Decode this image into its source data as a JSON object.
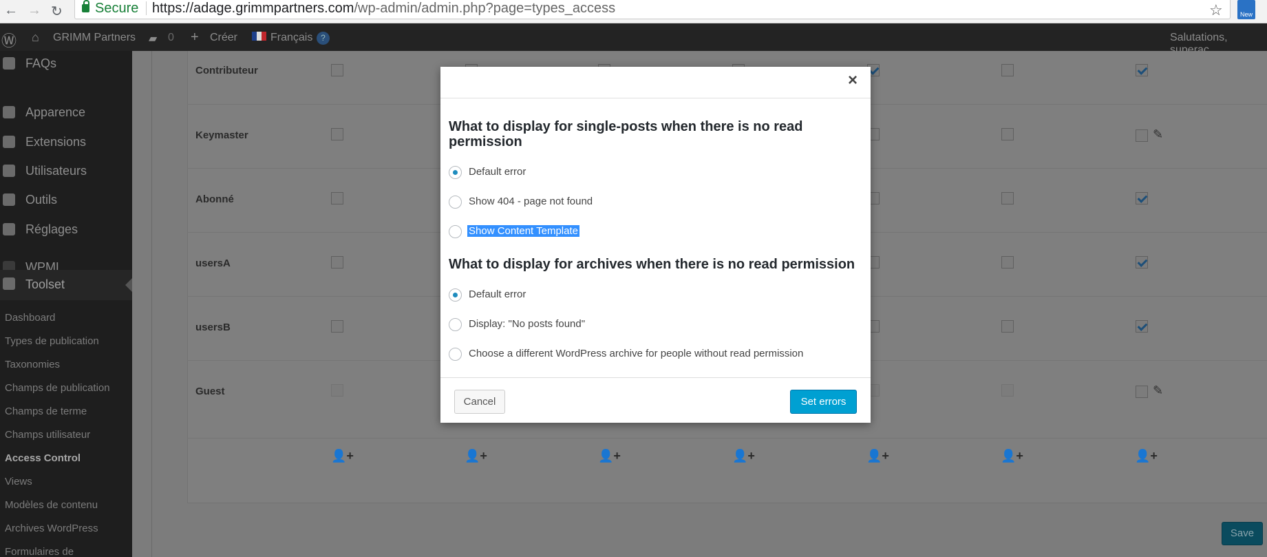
{
  "browser": {
    "secure_label": "Secure",
    "url_host": "https://adage.grimmpartners.com",
    "url_path": "/wp-admin/admin.php?page=types_access",
    "ext_badge": "New"
  },
  "adminbar": {
    "site_name": "GRIMM Partners",
    "comments_count": "0",
    "create_label": "Créer",
    "language": "Français",
    "greeting": "Salutations, superac"
  },
  "sidebar": {
    "menu": [
      "FAQs",
      "Apparence",
      "Extensions",
      "Utilisateurs",
      "Outils",
      "Réglages",
      "WPML",
      "Toolset"
    ],
    "submenu": [
      "Dashboard",
      "Types de publication",
      "Taxonomies",
      "Champs de publication",
      "Champs de terme",
      "Champs utilisateur",
      "Access Control",
      "Views",
      "Modèles de contenu",
      "Archives WordPress",
      "Formulaires de"
    ]
  },
  "table": {
    "roles": [
      "Contributeur",
      "Keymaster",
      "Abonné",
      "usersA",
      "usersB",
      "Guest"
    ],
    "save_label": "Save"
  },
  "modal": {
    "section1_title": "What to display for single-posts when there is no read permission",
    "section1_options": [
      "Default error",
      "Show 404 - page not found",
      "Show Content Template"
    ],
    "section1_selected": 0,
    "section2_title": "What to display for archives when there is no read permission",
    "section2_options": [
      "Default error",
      "Display: \"No posts found\"",
      "Choose a different WordPress archive for people without read permission"
    ],
    "section2_selected": 0,
    "cancel_label": "Cancel",
    "submit_label": "Set errors",
    "accent_color": "#00a0d2"
  }
}
